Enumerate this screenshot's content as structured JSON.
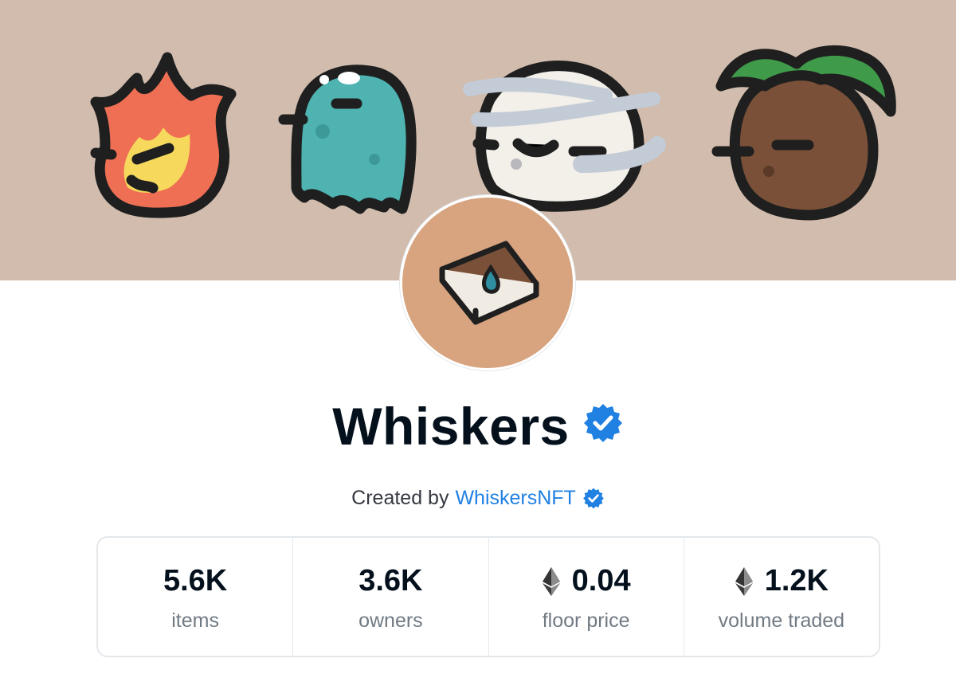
{
  "collection": {
    "name": "Whiskers",
    "verified_icon": "verified-badge-icon",
    "creator_prefix": "Created by",
    "creator_name": "WhiskersNFT"
  },
  "banner": {
    "background": "#d1bcad",
    "characters": [
      "fire-character",
      "ghost-character",
      "cloud-character",
      "coconut-character"
    ]
  },
  "avatar": {
    "icon": "book-with-water-drop-icon",
    "background": "#d7a47f"
  },
  "stats": [
    {
      "value": "5.6K",
      "label": "items",
      "currency_icon": null
    },
    {
      "value": "3.6K",
      "label": "owners",
      "currency_icon": null
    },
    {
      "value": "0.04",
      "label": "floor price",
      "currency_icon": "ethereum-icon"
    },
    {
      "value": "1.2K",
      "label": "volume traded",
      "currency_icon": "ethereum-icon"
    }
  ],
  "colors": {
    "link": "#2081e2",
    "verified": "#2081e2",
    "title": "#04111d",
    "label": "#707a83"
  }
}
